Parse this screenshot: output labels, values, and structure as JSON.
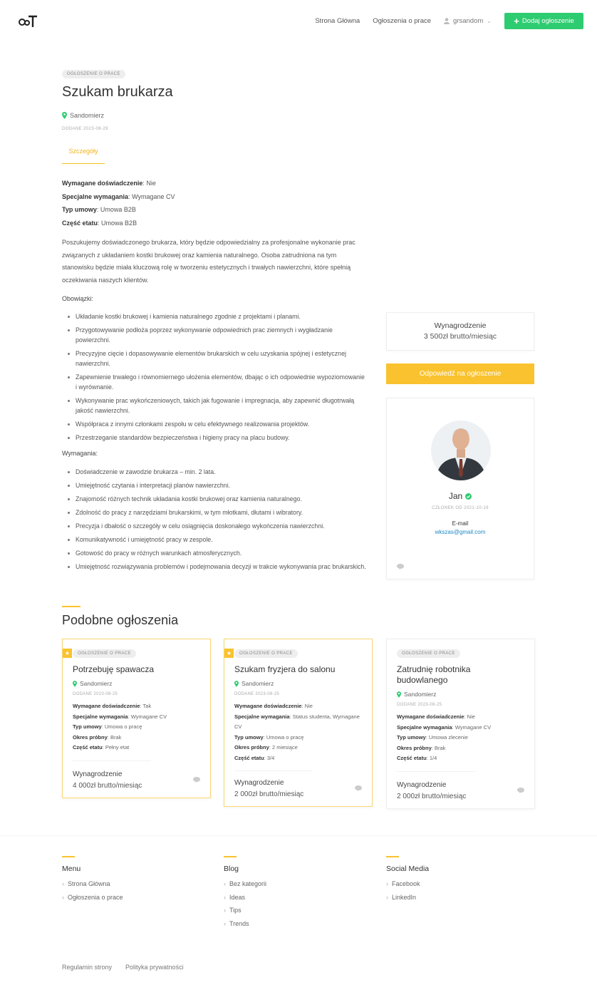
{
  "header": {
    "logo": "GoT",
    "nav": [
      "Strona Główna",
      "Ogłoszenia o prace"
    ],
    "user": "grsandom",
    "add_button": "Dodaj ogłoszenie"
  },
  "job": {
    "tag": "Ogłoszenie o prace",
    "title": "Szukam brukarza",
    "location": "Sandomierz",
    "date": "Dodane 2023-08-29",
    "tab": "Szczegóły",
    "specs": [
      {
        "label": "Wymagane doświadczenie",
        "value": "Nie"
      },
      {
        "label": "Specjalne wymagania",
        "value": "Wymagane CV"
      },
      {
        "label": "Typ umowy",
        "value": "Umowa B2B"
      },
      {
        "label": "Część etatu",
        "value": "Umowa B2B"
      }
    ],
    "description": "Poszukujemy doświadczonego brukarza, który będzie odpowiedzialny za profesjonalne wykonanie prac związanych z układaniem kostki brukowej oraz kamienia naturalnego. Osoba zatrudniona na tym stanowisku będzie miała kluczową rolę w tworzeniu estetycznych i trwałych nawierzchni, które spełnią oczekiwania naszych klientów.",
    "duties_heading": "Obowiązki:",
    "duties": [
      "Układanie kostki brukowej i kamienia naturalnego zgodnie z projektami i planami.",
      "Przygotowywanie podłoża poprzez wykonywanie odpowiednich prac ziemnych i wygładzanie powierzchni.",
      "Precyzyjne cięcie i dopasowywanie elementów brukarskich w celu uzyskania spójnej i estetycznej nawierzchni.",
      "Zapewnienie trwałego i równomiernego ułożenia elementów, dbając o ich odpowiednie wypoziomowanie i wyrównanie.",
      "Wykonywanie prac wykończeniowych, takich jak fugowanie i impregnacja, aby zapewnić długotrwałą jakość nawierzchni.",
      "Współpraca z innymi członkami zespołu w celu efektywnego realizowania projektów.",
      "Przestrzeganie standardów bezpieczeństwa i higieny pracy na placu budowy."
    ],
    "req_heading": "Wymagania:",
    "requirements": [
      "Doświadczenie w zawodzie brukarza – min. 2 lata.",
      "Umiejętność czytania i interpretacji planów nawierzchni.",
      "Znajomość różnych technik układania kostki brukowej oraz kamienia naturalnego.",
      "Zdolność do pracy z narzędziami brukarskimi, w tym młotkami, dłutami i wibratory.",
      "Precyzja i dbałość o szczegóły w celu osiągnięcia doskonałego wykończenia nawierzchni.",
      "Komunikatywność i umiejętność pracy w zespole.",
      "Gotowość do pracy w różnych warunkach atmosferycznych.",
      "Umiejętność rozwiązywania problemów i podejmowania decyzji w trakcie wykonywania prac brukarskich."
    ]
  },
  "sidebar": {
    "salary_label": "Wynagrodzenie",
    "salary_value": "3 500zł brutto/miesiąc",
    "reply_button": "Odpowiedź na ogłoszenie",
    "profile": {
      "name": "Jan",
      "member_since": "Członek od 2021-10-19",
      "email_label": "E-mail",
      "email": "wkszas@gmail.com"
    }
  },
  "similar": {
    "heading": "Podobne ogłoszenia",
    "cards": [
      {
        "tag": "Ogłoszenie o prace",
        "title": "Potrzebuję spawacza",
        "location": "Sandomierz",
        "date": "Dodane 2023-08-25",
        "specs": [
          {
            "label": "Wymagane doświadczenie",
            "value": "Tak"
          },
          {
            "label": "Specjalne wymagania",
            "value": "Wymagane CV"
          },
          {
            "label": "Typ umowy",
            "value": "Umowa o pracę"
          },
          {
            "label": "Okres próbny",
            "value": "Brak"
          },
          {
            "label": "Część etatu",
            "value": "Pełny etat"
          }
        ],
        "salary_label": "Wynagrodzenie",
        "salary_value": "4 000zł brutto/miesiąc"
      },
      {
        "tag": "Ogłoszenie o prace",
        "title": "Szukam fryzjera do salonu",
        "location": "Sandomierz",
        "date": "Dodane 2023-08-25",
        "specs": [
          {
            "label": "Wymagane doświadczenie",
            "value": "Nie"
          },
          {
            "label": "Specjalne wymagania",
            "value": "Status studenta, Wymagane CV"
          },
          {
            "label": "Typ umowy",
            "value": "Umowa o pracę"
          },
          {
            "label": "Okres próbny",
            "value": "2 miesiące"
          },
          {
            "label": "Część etatu",
            "value": "3/4"
          }
        ],
        "salary_label": "Wynagrodzenie",
        "salary_value": "2 000zł brutto/miesiąc"
      },
      {
        "tag": "Ogłoszenie o prace",
        "title": "Zatrudnię robotnika budowlanego",
        "location": "Sandomierz",
        "date": "Dodane 2023-08-25",
        "specs": [
          {
            "label": "Wymagane doświadczenie",
            "value": "Nie"
          },
          {
            "label": "Specjalne wymagania",
            "value": "Wymagane CV"
          },
          {
            "label": "Typ umowy",
            "value": "Umowa zlecenie"
          },
          {
            "label": "Okres próbny",
            "value": "Brak"
          },
          {
            "label": "Część etatu",
            "value": "1/4"
          }
        ],
        "salary_label": "Wynagrodzenie",
        "salary_value": "2 000zł brutto/miesiąc"
      }
    ]
  },
  "footer": {
    "menu": {
      "heading": "Menu",
      "items": [
        "Strona Główna",
        "Ogłoszenia o prace"
      ]
    },
    "blog": {
      "heading": "Blog",
      "items": [
        "Bez kategorii",
        "Ideas",
        "Tips",
        "Trends"
      ]
    },
    "social": {
      "heading": "Social Media",
      "items": [
        "Facebook",
        "LinkedIn"
      ]
    },
    "bottom_links": [
      "Regulamin strony",
      "Polityka prywatności"
    ]
  },
  "colors": {
    "accent": "#f9c22e",
    "green": "#2ecc71",
    "link": "#1e88c8"
  }
}
